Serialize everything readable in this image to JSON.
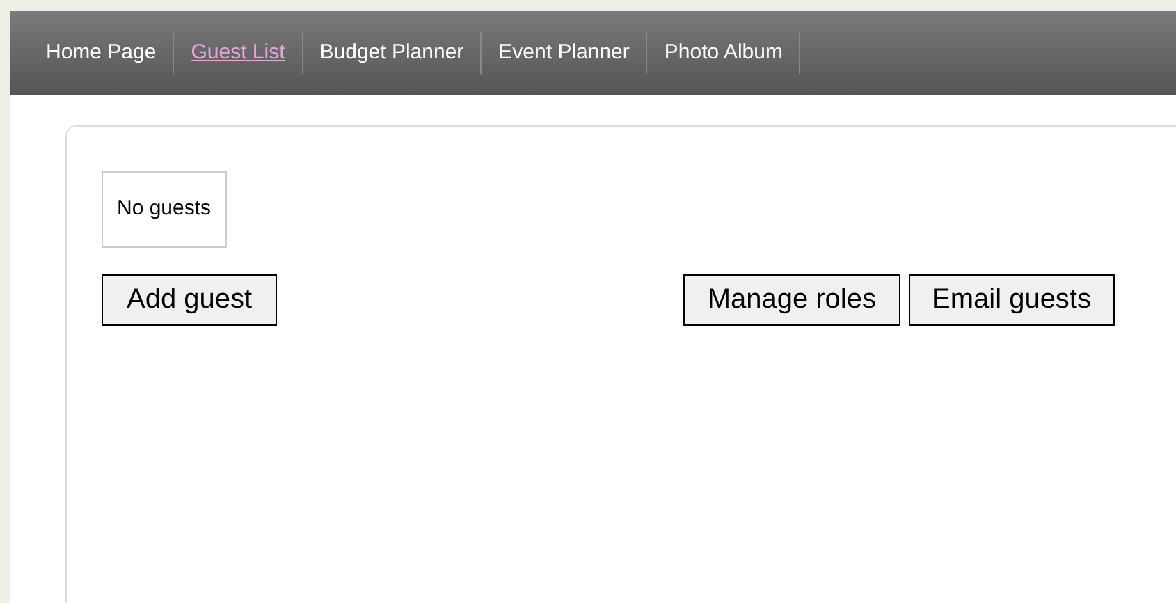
{
  "nav": [
    {
      "label": "Home Page",
      "selected": false
    },
    {
      "label": "Guest List",
      "selected": true
    },
    {
      "label": "Budget Planner",
      "selected": false
    },
    {
      "label": "Event Planner",
      "selected": false
    },
    {
      "label": "Photo Album",
      "selected": false
    }
  ],
  "guest_status": "No guests",
  "buttons": {
    "left": [
      "Add guest"
    ],
    "right": [
      "Manage roles",
      "Email guests"
    ]
  }
}
